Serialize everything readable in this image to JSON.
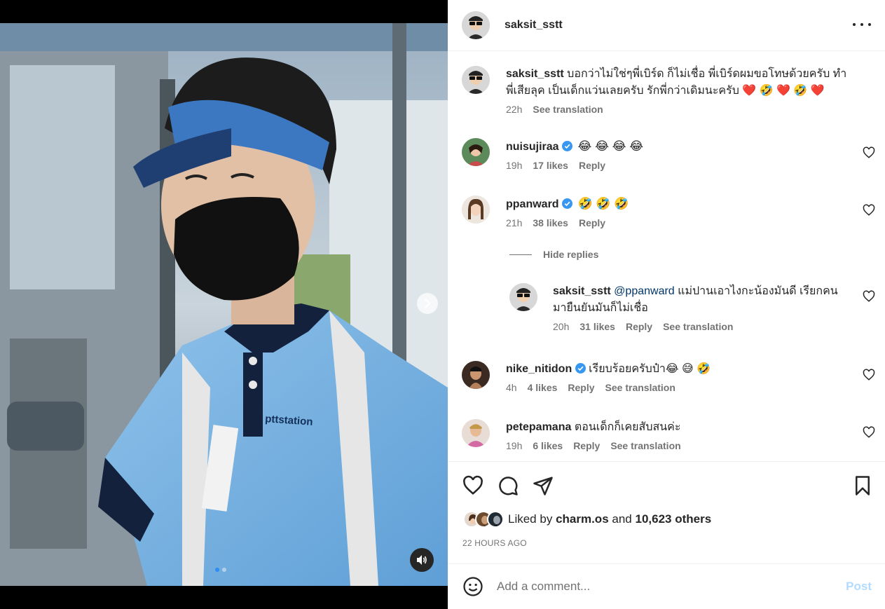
{
  "post": {
    "author": "saksit_sstt",
    "more_icon": "more-horizontal-icon"
  },
  "caption": {
    "username": "saksit_sstt",
    "text_line1": "บอกว่าไม่ใช่ๆพี่เบิร์ด ก็ไม่เชื่อ พี่เบิร์ดผมขอโทษด้วยครับ ทำ",
    "text_line2": "พี่เสียลุค เป็นเด็กแว่นเลยครับ รักพี่กว่าเดิมนะครับ",
    "emojis": "❤️ 🤣 ❤️ 🤣 ❤️",
    "time": "22h",
    "see_translation": "See translation"
  },
  "comments": [
    {
      "username": "nuisujiraa",
      "verified": true,
      "text": "😂 😂 😂 😂",
      "time": "19h",
      "likes": "17 likes",
      "reply": "Reply"
    },
    {
      "username": "ppanward",
      "verified": true,
      "text": "🤣 🤣 🤣",
      "time": "21h",
      "likes": "38 likes",
      "reply": "Reply"
    },
    {
      "username": "nike_nitidon",
      "verified": true,
      "text": "เรียบร้อยครับป๋า😂 😅 🤣",
      "time": "4h",
      "likes": "4 likes",
      "reply": "Reply",
      "see_translation": "See translation"
    },
    {
      "username": "petepamana",
      "verified": false,
      "text": "ตอนเด็กก็เคยสับสนค่ะ",
      "time": "19h",
      "likes": "6 likes",
      "reply": "Reply",
      "see_translation": "See translation"
    }
  ],
  "replies_toggle": "Hide replies",
  "reply": {
    "username": "saksit_sstt",
    "mention": "@ppanward",
    "text_line1": "แม่ปานเอาไงกะน้องมันดี เรียกคน",
    "text_line2": "มายืนยันมันก็ไม่เชื่อ",
    "time": "20h",
    "likes": "31 likes",
    "reply": "Reply",
    "see_translation": "See translation"
  },
  "liked_by": {
    "prefix": "Liked by",
    "user": "charm.os",
    "and": "and",
    "others": "10,623 others"
  },
  "timestamp": "22 HOURS AGO",
  "add_comment": {
    "placeholder": "Add a comment...",
    "post_label": "Post"
  },
  "colors": {
    "verified": "#3897f0",
    "link": "#00376b",
    "post_disabled": "#b3dbff",
    "secondary_text": "#737373"
  },
  "media": {
    "shirt_brand": "pttstation",
    "carousel_count": 2,
    "carousel_active": 0
  }
}
